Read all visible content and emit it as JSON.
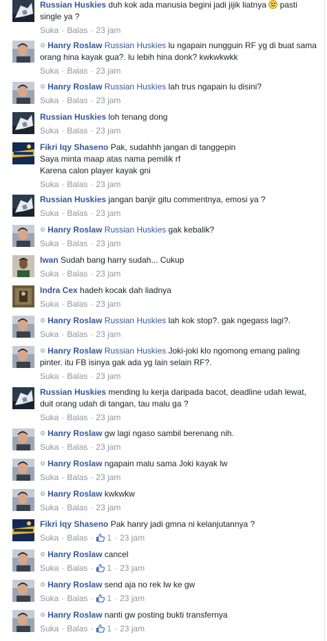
{
  "labels": {
    "like": "Suka",
    "reply": "Balas",
    "time": "23 jam"
  },
  "comments": [
    {
      "avatar": "huskies",
      "name": "Russian Huskies",
      "prefix": "",
      "mention": "",
      "text": "duh kok ada manusia begini jadi jijik liatnya",
      "suffix": "pasti single ya ?",
      "emoji": "confused-smiley",
      "likes": ""
    },
    {
      "avatar": "hanry",
      "name": "Hanry Roslaw",
      "prefix": "gear",
      "mention": "Russian Huskies",
      "text": "lu ngapain nungguin RF yg di buat sama orang hina kayak gua?. lu lebih hina donk? kwkwkwkk",
      "likes": ""
    },
    {
      "avatar": "hanry",
      "name": "Hanry Roslaw",
      "prefix": "gear",
      "mention": "Russian Huskies",
      "text": "lah trus ngapain lu disini?",
      "likes": ""
    },
    {
      "avatar": "huskies",
      "name": "Russian Huskies",
      "prefix": "",
      "mention": "",
      "text": "loh tenang dong",
      "likes": ""
    },
    {
      "avatar": "fikri",
      "name": "Fikri Iqy Shaseno",
      "prefix": "",
      "mention": "",
      "text": "Pak, sudahhh jangan di tanggepin\nSaya minta maap atas nama pemilik rf\nKarena calon player kayak gni",
      "likes": ""
    },
    {
      "avatar": "huskies",
      "name": "Russian Huskies",
      "prefix": "",
      "mention": "",
      "text": "jangan banjir gitu commentnya, emosi ya ?",
      "likes": ""
    },
    {
      "avatar": "hanry",
      "name": "Hanry Roslaw",
      "prefix": "gear",
      "mention": "Russian Huskies",
      "text": "gak kebalik?",
      "likes": ""
    },
    {
      "avatar": "iwan",
      "name": "Iwan",
      "prefix": "",
      "mention": "",
      "text": "Sudah bang harry sudah... Cukup",
      "likes": ""
    },
    {
      "avatar": "indra",
      "name": "Indra Cex",
      "prefix": "",
      "mention": "",
      "text": "hadeh kocak dah liadnya",
      "likes": ""
    },
    {
      "avatar": "hanry",
      "name": "Hanry Roslaw",
      "prefix": "gear",
      "mention": "Russian Huskies",
      "text": "lah kok stop?. gak ngegass lagi?.",
      "likes": ""
    },
    {
      "avatar": "hanry",
      "name": "Hanry Roslaw",
      "prefix": "gear",
      "mention": "Russian Huskies",
      "text": "Joki-joki klo ngomong emang paling pinter. itu FB isinya gak ada yg lain selain RF?.",
      "likes": ""
    },
    {
      "avatar": "huskies",
      "name": "Russian Huskies",
      "prefix": "",
      "mention": "",
      "text": "mending lu kerja daripada bacot, deadline udah lewat, duit orang udah di tangan, tau malu ga ?",
      "likes": ""
    },
    {
      "avatar": "hanry",
      "name": "Hanry Roslaw",
      "prefix": "gear",
      "mention": "",
      "text": "gw lagi ngaso sambil berenang nih.",
      "likes": ""
    },
    {
      "avatar": "hanry",
      "name": "Hanry Roslaw",
      "prefix": "gear",
      "mention": "",
      "text": "ngapain malu sama Joki kayak lw",
      "likes": ""
    },
    {
      "avatar": "hanry",
      "name": "Hanry Roslaw",
      "prefix": "gear",
      "mention": "",
      "text": "kwkwkw",
      "likes": ""
    },
    {
      "avatar": "fikri",
      "name": "Fikri Iqy Shaseno",
      "prefix": "",
      "mention": "",
      "text": "Pak hanry jadi gmna ni kelanjutannya ?",
      "likes": "1"
    },
    {
      "avatar": "hanry",
      "name": "Hanry Roslaw",
      "prefix": "gear",
      "mention": "",
      "text": "cancel",
      "likes": "1"
    },
    {
      "avatar": "hanry",
      "name": "Hanry Roslaw",
      "prefix": "gear",
      "mention": "",
      "text": "send aja no rek lw ke gw",
      "likes": "1"
    },
    {
      "avatar": "hanry",
      "name": "Hanry Roslaw",
      "prefix": "gear",
      "mention": "",
      "text": "nanti gw posting bukti transfernya",
      "likes": "1"
    }
  ]
}
